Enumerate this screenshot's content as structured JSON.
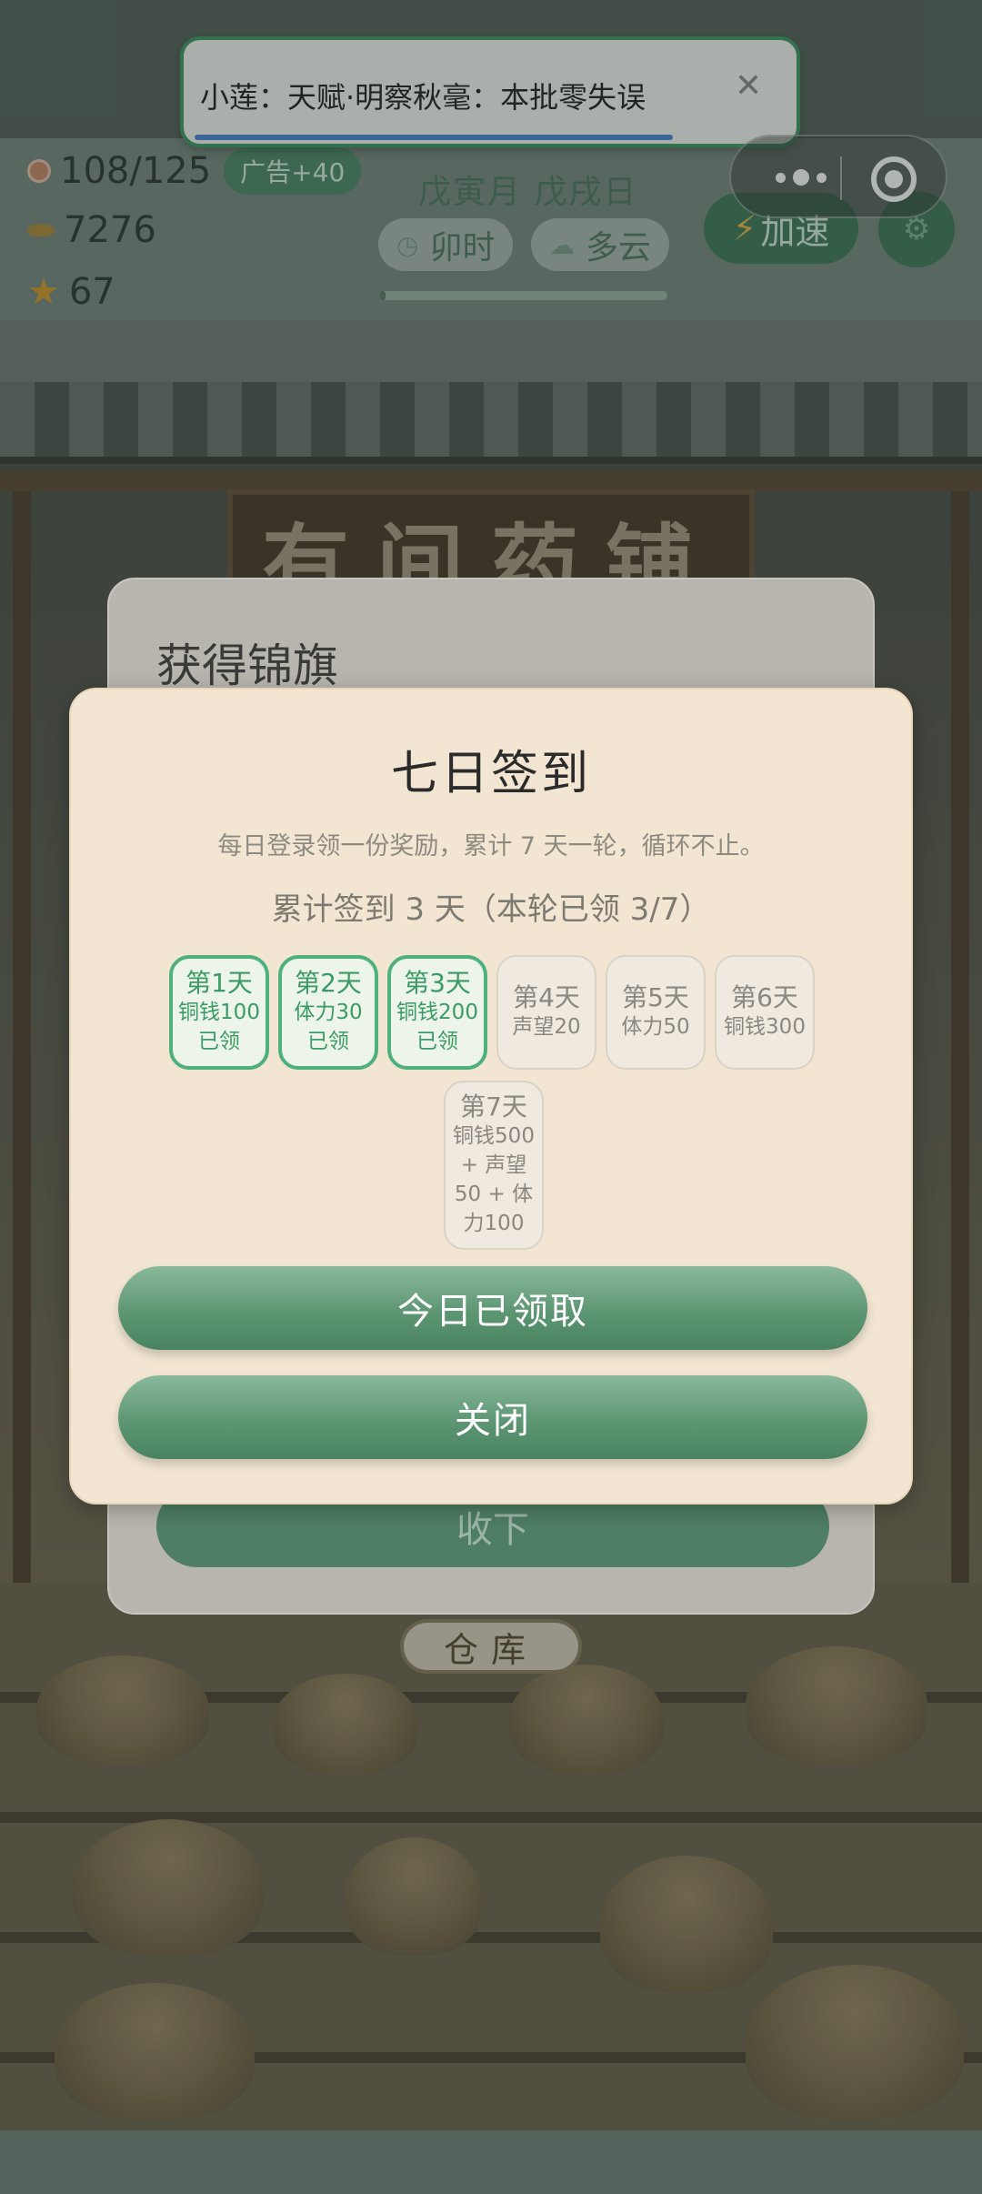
{
  "background": {
    "shop_sign": "有间药铺",
    "storage_label": "仓库"
  },
  "hud": {
    "coins": "108/125",
    "ad_bonus": "广告+40",
    "ingots": "7276",
    "stars": "67",
    "date": "戊寅月 戊戌日",
    "time_of_day": "卯时",
    "weather": "多云",
    "day_progress": 0.02,
    "speed_label": "加速"
  },
  "toast": {
    "message": "小莲：天赋·明察秋毫：本批零失误"
  },
  "pennant_dialog": {
    "title": "获得锦旗",
    "button_label": "收下"
  },
  "signin": {
    "title": "七日签到",
    "description": "每日登录领一份奖励，累计 7 天一轮，循环不止。",
    "progress_text": "累计签到 3 天（本轮已领 3/7）",
    "days": [
      {
        "name": "第1天",
        "reward": "铜钱100",
        "state": "已领"
      },
      {
        "name": "第2天",
        "reward": "体力30",
        "state": "已领"
      },
      {
        "name": "第3天",
        "reward": "铜钱200",
        "state": "已领"
      },
      {
        "name": "第4天",
        "reward": "声望20",
        "state": ""
      },
      {
        "name": "第5天",
        "reward": "体力50",
        "state": ""
      },
      {
        "name": "第6天",
        "reward": "铜钱300",
        "state": ""
      },
      {
        "name": "第7天",
        "reward": "铜钱500 + 声望50 + 体力100",
        "state": ""
      }
    ],
    "claim_button": "今日已领取",
    "close_button": "关闭"
  },
  "colors": {
    "accent_green": "#3f7a5a",
    "claimed_border": "#4eb07a",
    "dialog_bg": "#f2e6d2"
  }
}
